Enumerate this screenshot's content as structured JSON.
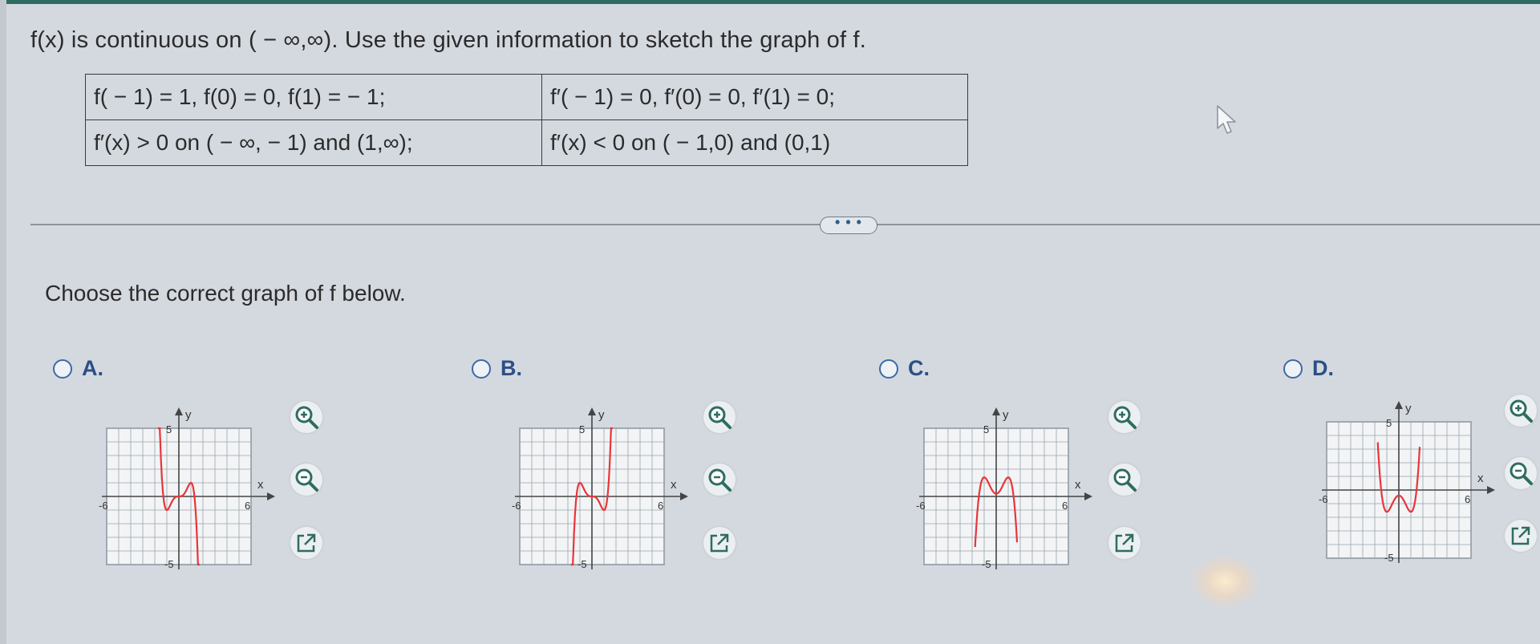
{
  "problem": {
    "statement": "f(x) is continuous on ( − ∞,∞). Use the given information to sketch the graph of f.",
    "table": [
      [
        "f( − 1) = 1, f(0) = 0, f(1) = − 1;",
        "f′( − 1) = 0, f′(0) = 0, f′(1) = 0;"
      ],
      [
        "f′(x) > 0 on ( − ∞, − 1) and (1,∞);",
        "f′(x) < 0 on ( − 1,0) and (0,1)"
      ]
    ]
  },
  "more_button": "• • •",
  "prompt": "Choose the correct graph of f below.",
  "options": [
    {
      "letter": "A.",
      "axis": {
        "y": "y",
        "x": "x",
        "xmin": "-6",
        "xmax": "6",
        "ymax": "5",
        "ymin": "-5"
      }
    },
    {
      "letter": "B.",
      "axis": {
        "y": "y",
        "x": "x",
        "xmin": "-6",
        "xmax": "6",
        "ymax": "5",
        "ymin": "-5"
      }
    },
    {
      "letter": "C.",
      "axis": {
        "y": "y",
        "x": "x",
        "xmin": "-6",
        "xmax": "6",
        "ymax": "5",
        "ymin": "-5"
      }
    },
    {
      "letter": "D.",
      "axis": {
        "y": "y",
        "x": "x",
        "xmin": "-6",
        "xmax": "6",
        "ymax": "5",
        "ymin": "-5"
      }
    }
  ],
  "tools": [
    "zoom-in-icon",
    "zoom-out-icon",
    "open-new-window-icon"
  ],
  "colors": {
    "curve": "#e8353a",
    "grid": "#9aa3ad",
    "radio": "#3b6aa8",
    "top_bar": "#2d6b63"
  }
}
